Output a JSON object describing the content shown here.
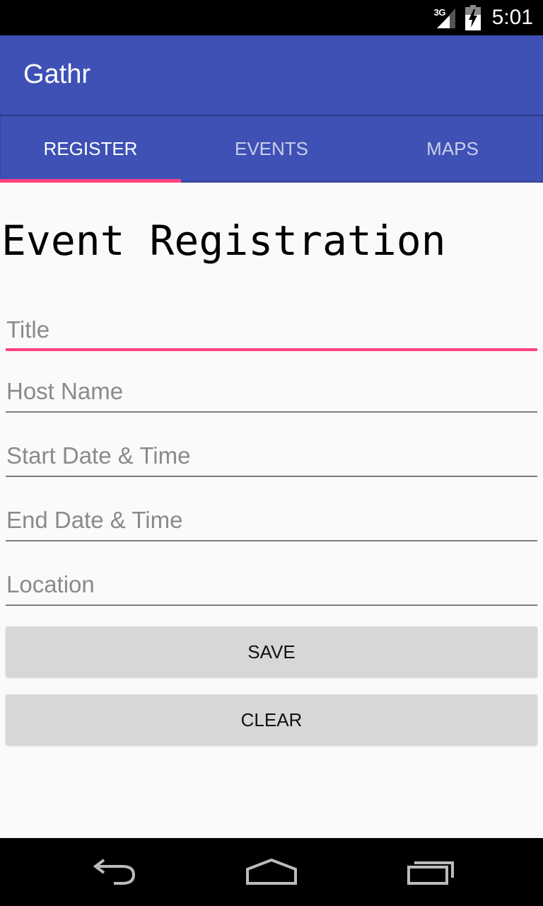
{
  "status_bar": {
    "network": "3G",
    "time": "5:01"
  },
  "app_bar": {
    "title": "Gathr"
  },
  "tabs": [
    {
      "label": "REGISTER",
      "active": true
    },
    {
      "label": "EVENTS",
      "active": false
    },
    {
      "label": "MAPS",
      "active": false
    }
  ],
  "form": {
    "heading": "Event Registration",
    "fields": [
      {
        "placeholder": "Title",
        "value": ""
      },
      {
        "placeholder": "Host Name",
        "value": ""
      },
      {
        "placeholder": "Start Date & Time",
        "value": ""
      },
      {
        "placeholder": "End Date & Time",
        "value": ""
      },
      {
        "placeholder": "Location",
        "value": ""
      }
    ],
    "save_label": "SAVE",
    "clear_label": "CLEAR"
  },
  "colors": {
    "primary": "#3f51b5",
    "accent": "#ff4081",
    "background": "#fafafa",
    "button": "#d6d7d7"
  },
  "icons": {
    "signal": "signal-icon",
    "battery": "battery-icon",
    "back": "back-icon",
    "home": "home-icon",
    "recents": "recents-icon"
  }
}
